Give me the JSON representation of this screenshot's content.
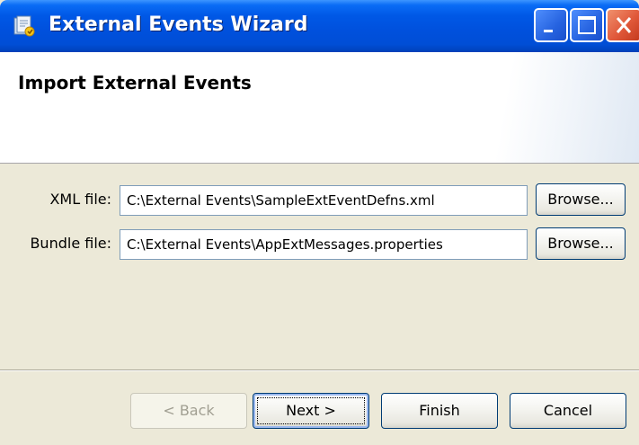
{
  "window": {
    "title": "External Events Wizard",
    "title_icon": "wizard-app-icon",
    "controls": [
      "minimize-icon",
      "maximize-icon",
      "close-icon"
    ]
  },
  "header": {
    "title": "Import External Events"
  },
  "form": {
    "xml_label": "XML file:",
    "xml_value": "C:\\External Events\\SampleExtEventDefns.xml",
    "xml_browse": "Browse...",
    "bundle_label": "Bundle file:",
    "bundle_value": "C:\\External Events\\AppExtMessages.properties",
    "bundle_browse": "Browse..."
  },
  "footer": {
    "back": "< Back",
    "next": "Next >",
    "finish": "Finish",
    "cancel": "Cancel",
    "back_enabled": false
  },
  "colors": {
    "titlebar": "#0054e3",
    "close_button": "#e0583a",
    "dialog_background": "#ece9d8"
  }
}
